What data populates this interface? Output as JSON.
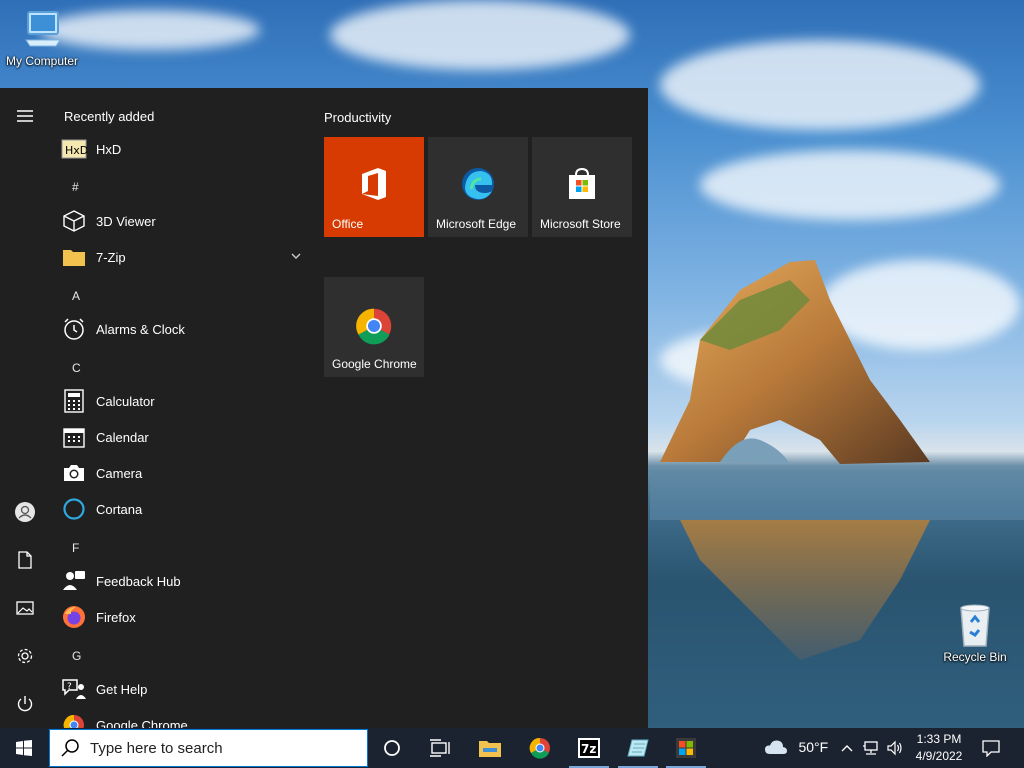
{
  "desktop": {
    "icons": [
      {
        "label": "My Computer"
      },
      {
        "label": "Recycle Bin"
      }
    ]
  },
  "start_menu": {
    "recently_added_title": "Recently added",
    "apps": [
      {
        "label": "HxD"
      },
      {
        "letter": "#"
      },
      {
        "label": "3D Viewer"
      },
      {
        "label": "7-Zip"
      },
      {
        "letter": "A"
      },
      {
        "label": "Alarms & Clock"
      },
      {
        "letter": "C"
      },
      {
        "label": "Calculator"
      },
      {
        "label": "Calendar"
      },
      {
        "label": "Camera"
      },
      {
        "label": "Cortana"
      },
      {
        "letter": "F"
      },
      {
        "label": "Feedback Hub"
      },
      {
        "label": "Firefox"
      },
      {
        "letter": "G"
      },
      {
        "label": "Get Help"
      },
      {
        "label": "Google Chrome"
      }
    ],
    "tile_group_title": "Productivity",
    "tiles": [
      {
        "label": "Office"
      },
      {
        "label": "Microsoft Edge"
      },
      {
        "label": "Microsoft Store"
      },
      {
        "label": "Google Chrome"
      }
    ]
  },
  "taskbar": {
    "search_placeholder": "Type here to search",
    "weather": "50°F",
    "time": "1:33 PM",
    "date": "4/9/2022"
  },
  "colors": {
    "office_tile": "#d83b01",
    "tile_bg": "#2f2f2f",
    "menu_bg": "#202020",
    "taskbar_bg": "#1b2230"
  }
}
